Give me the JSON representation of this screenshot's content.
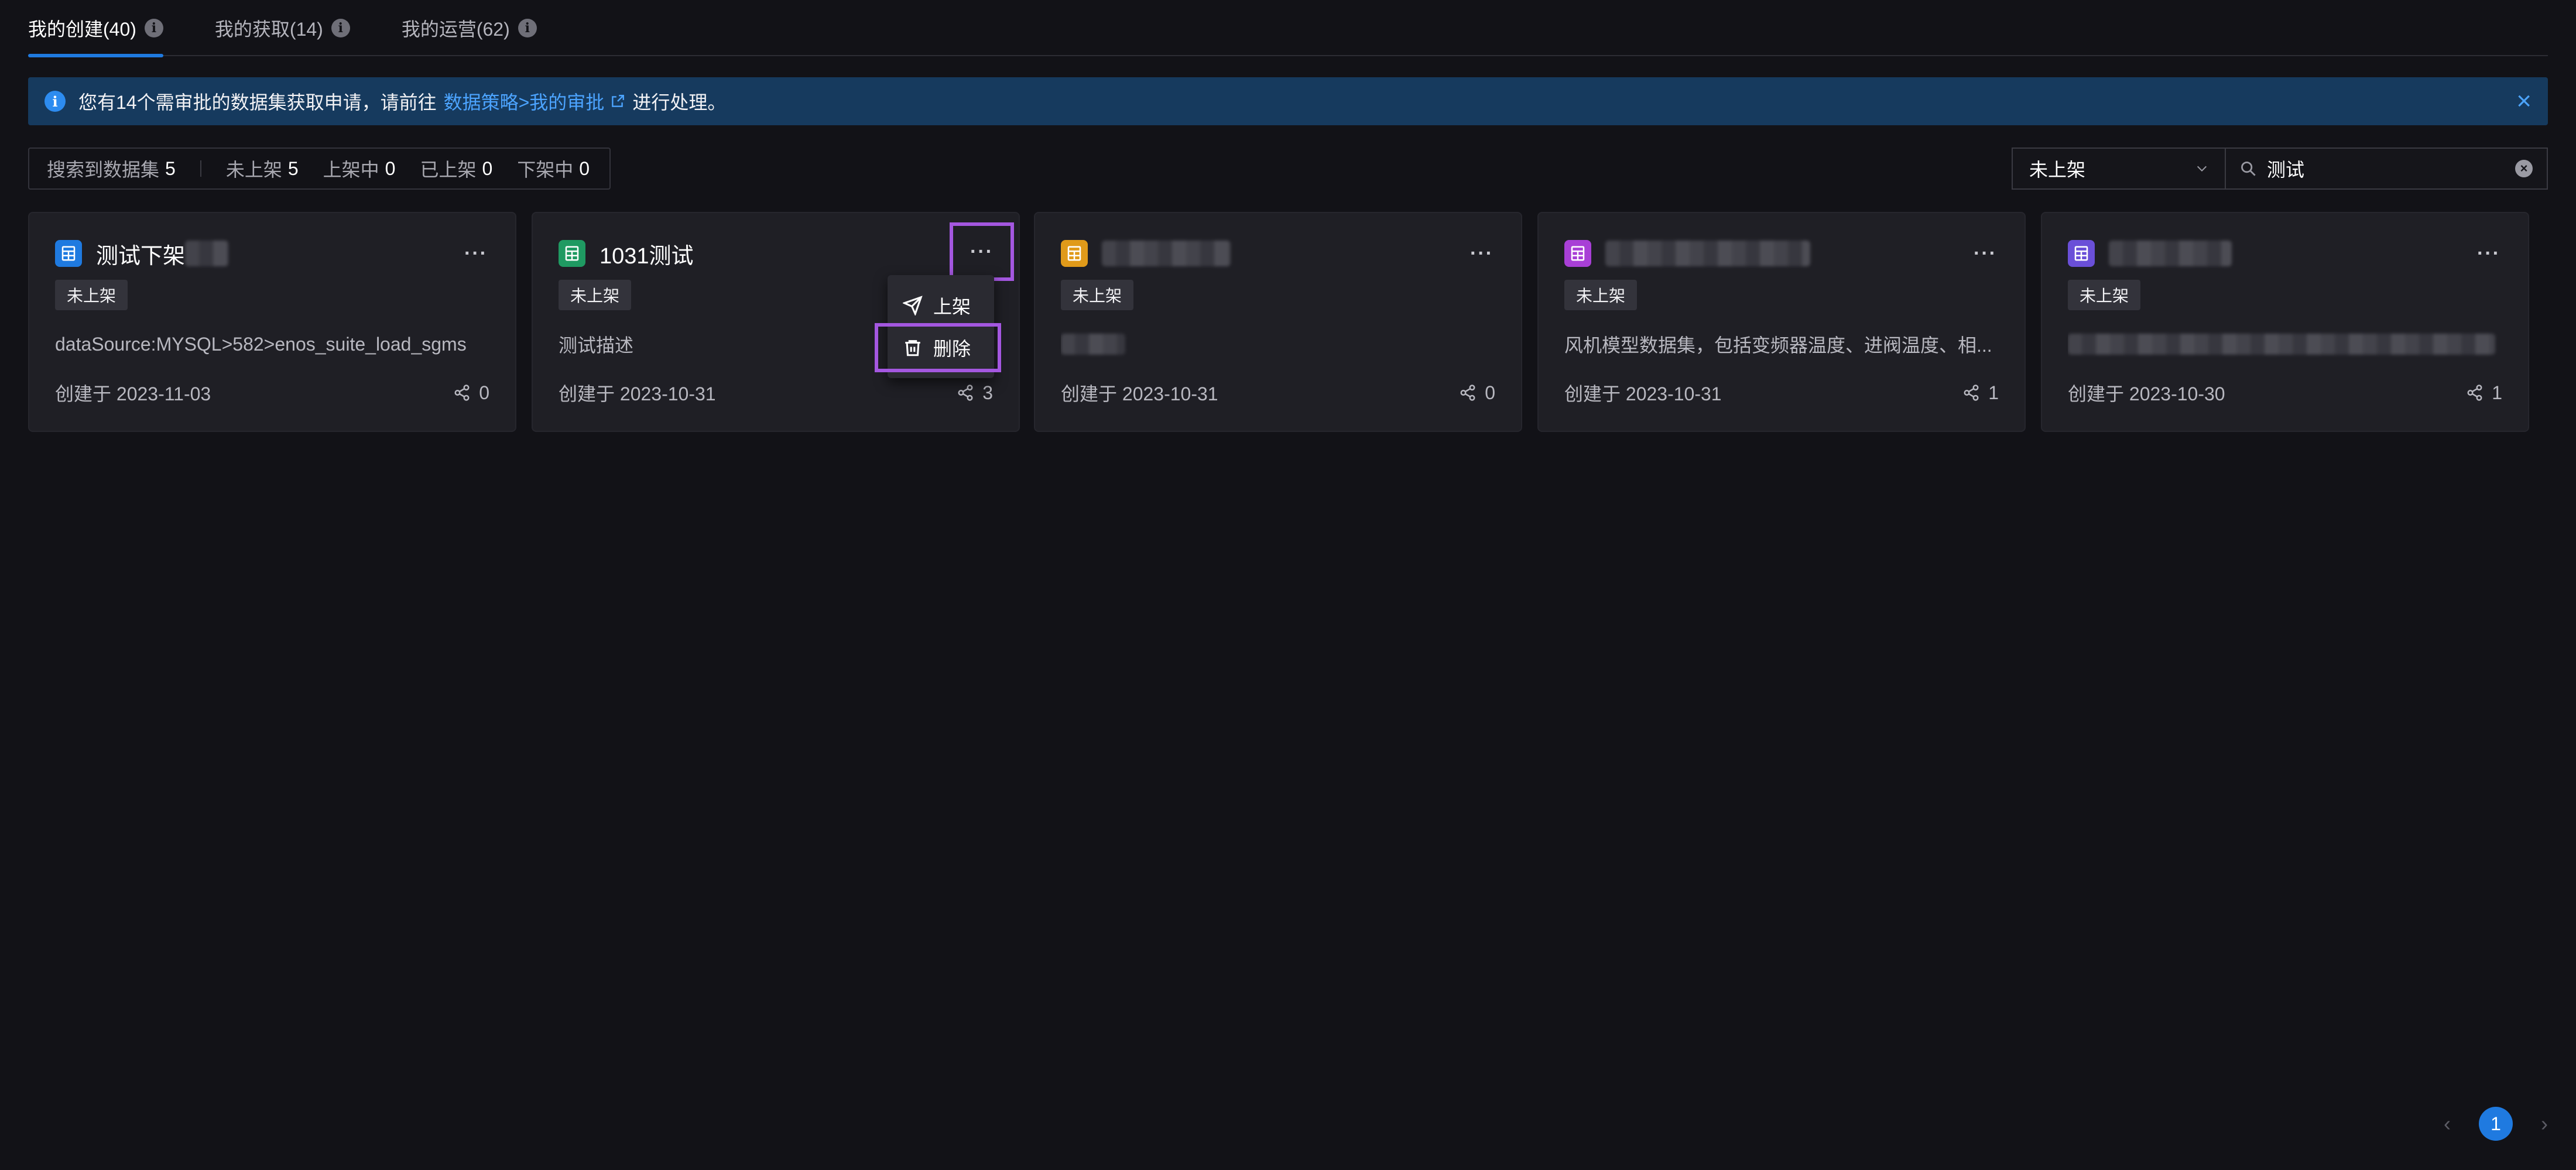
{
  "tabs": [
    {
      "label": "我的创建(40)"
    },
    {
      "label": "我的获取(14)"
    },
    {
      "label": "我的运营(62)"
    }
  ],
  "notice": {
    "text": "您有14个需审批的数据集获取申请，请前往",
    "link": "数据策略>我的审批",
    "after": "进行处理。",
    "close": "×"
  },
  "stats": [
    {
      "label": "搜索到数据集",
      "value": "5"
    },
    {
      "label": "未上架",
      "value": "5"
    },
    {
      "label": "上架中",
      "value": "0"
    },
    {
      "label": "已上架",
      "value": "0"
    },
    {
      "label": "下架中",
      "value": "0"
    }
  ],
  "filter": {
    "status": "未上架",
    "search_value": "测试"
  },
  "cards": [
    {
      "title": "测试下架",
      "badge": "未上架",
      "desc": "dataSource:MYSQL>582>enos_suite_load_sgms",
      "date": "创建于 2023-11-03",
      "shares": "0",
      "icon_color": "#1f7ae0"
    },
    {
      "title": "1031测试",
      "badge": "未上架",
      "desc": "测试描述",
      "date": "创建于 2023-10-31",
      "shares": "3",
      "icon_color": "#1f9a62"
    },
    {
      "title": "",
      "badge": "未上架",
      "desc": "",
      "date": "创建于 2023-10-31",
      "shares": "0",
      "icon_color": "#e09a1a"
    },
    {
      "title": "",
      "badge": "未上架",
      "desc": "风机模型数据集，包括变频器温度、进阀温度、相...",
      "date": "创建于 2023-10-31",
      "shares": "1",
      "icon_color": "#a83fd6"
    },
    {
      "title": "",
      "badge": "未上架",
      "desc": "",
      "date": "创建于 2023-10-30",
      "shares": "1",
      "icon_color": "#6a4fd8"
    }
  ],
  "more_glyph": "···",
  "menu": {
    "publish": "上架",
    "delete": "删除"
  },
  "pagination": {
    "current": "1",
    "prev": "‹",
    "next": "›"
  }
}
